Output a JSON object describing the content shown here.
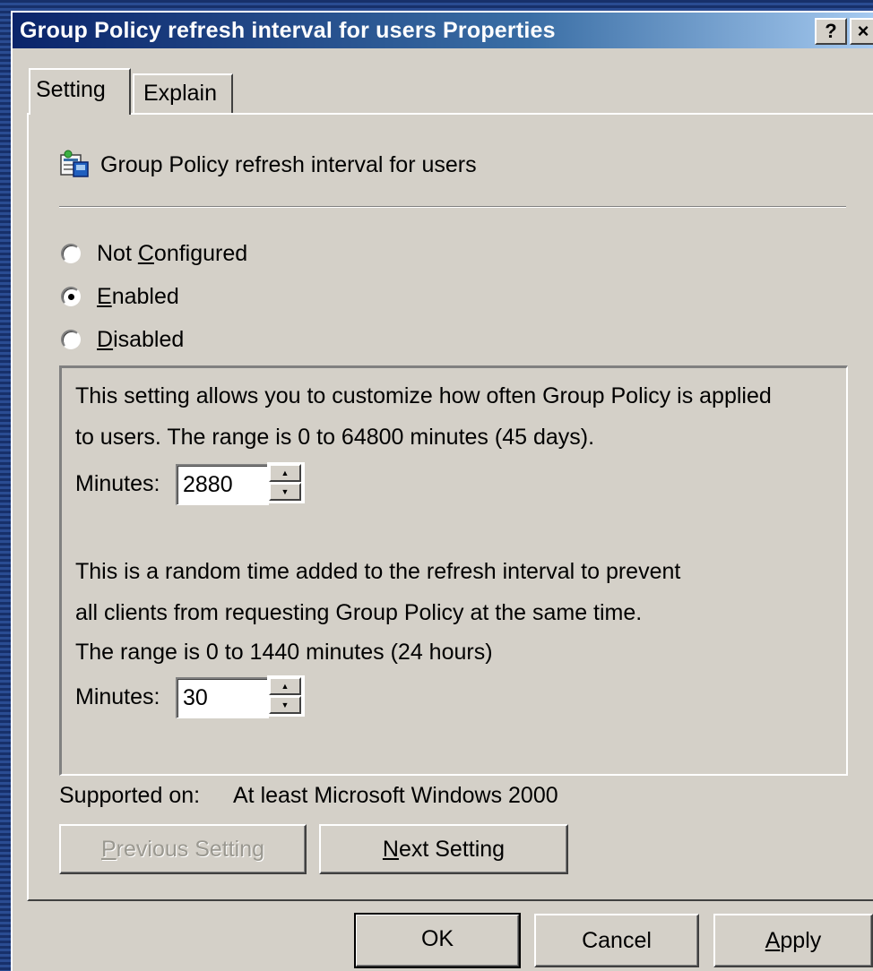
{
  "window": {
    "title": "Group Policy refresh interval for users Properties",
    "help_label": "?",
    "close_label": "×"
  },
  "tabs": [
    {
      "label": "Setting",
      "active": true
    },
    {
      "label": "Explain",
      "active": false
    }
  ],
  "policy": {
    "name": "Group Policy refresh interval for users",
    "icon": "policy-settings-icon"
  },
  "radios": [
    {
      "pre": "Not ",
      "accel": "C",
      "post": "onfigured",
      "checked": false
    },
    {
      "pre": "",
      "accel": "E",
      "post": "nabled",
      "checked": true
    },
    {
      "pre": "",
      "accel": "D",
      "post": "isabled",
      "checked": false
    }
  ],
  "options": {
    "desc1_line1": "This setting allows you to customize how often Group Policy is applied",
    "desc1_line2": "to users. The range is 0 to 64800 minutes (45 days).",
    "minutes_label": "Minutes:",
    "interval_value": "2880",
    "desc2_line1": "This is a random time added to the refresh interval to prevent",
    "desc2_line2": "all clients from requesting Group Policy at the same time.",
    "desc2_line3": "The range is 0 to 1440 minutes (24 hours)",
    "offset_value": "30"
  },
  "supported": {
    "label": "Supported on:",
    "value": "At least Microsoft Windows 2000"
  },
  "nav": {
    "prev_accel": "P",
    "prev_rest": "revious Setting",
    "next_accel": "N",
    "next_rest": "ext Setting"
  },
  "footer": {
    "ok_label": "OK",
    "cancel_label": "Cancel",
    "apply_accel": "A",
    "apply_rest": "pply"
  },
  "colors": {
    "title_gradient_start": "#0a246a",
    "title_gradient_end": "#a6caf0",
    "dialog_face": "#d4d0c8"
  }
}
